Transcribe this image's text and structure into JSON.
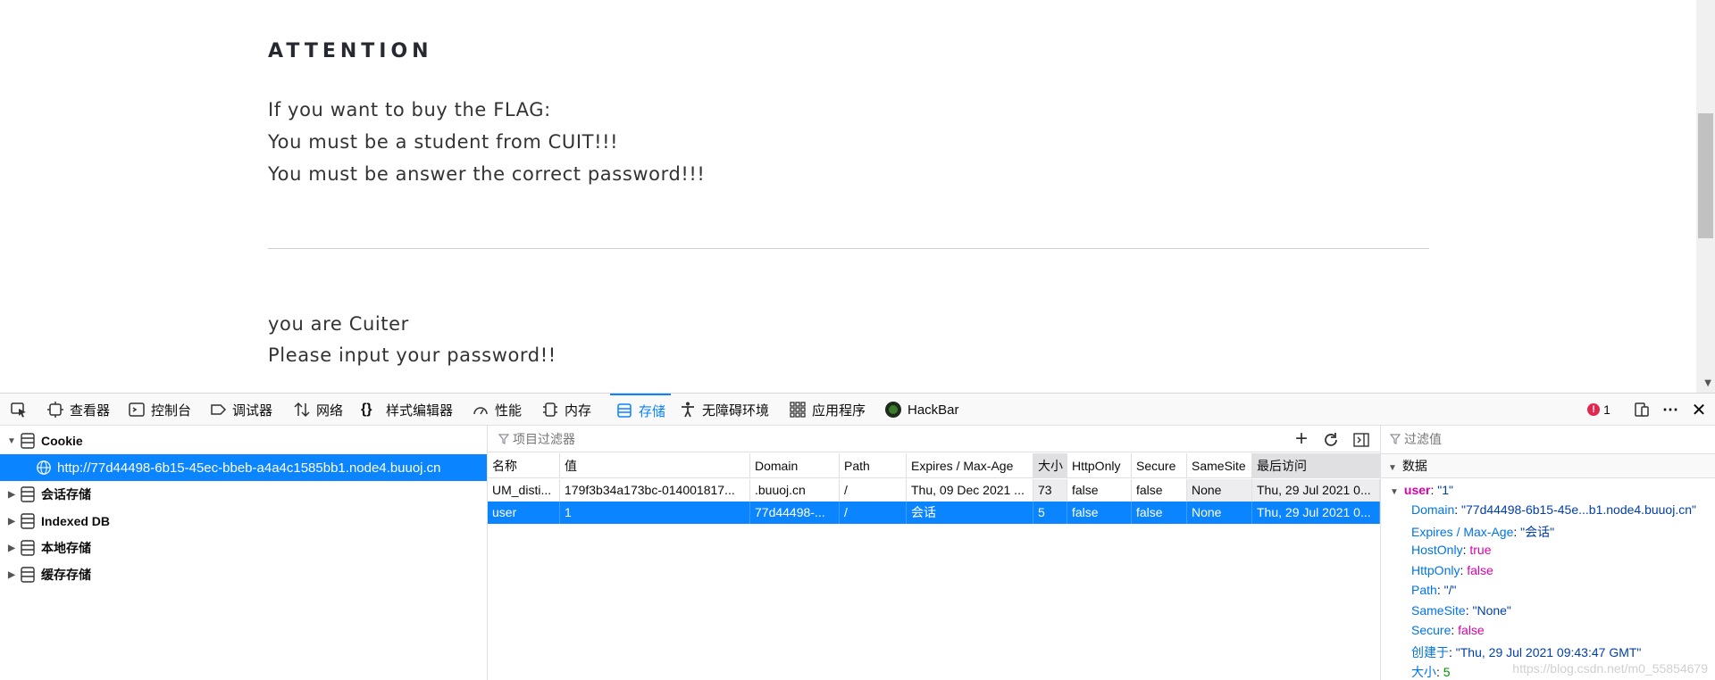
{
  "page": {
    "heading": "ATTENTION",
    "lines": [
      "If you want to buy the FLAG:",
      "You must be a student from CUIT!!!",
      "You must be answer the correct password!!!"
    ],
    "lines2": [
      "you are Cuiter",
      "Please input your password!!"
    ]
  },
  "devtools": {
    "tools": [
      {
        "label": "查看器",
        "icon": "inspector-icon"
      },
      {
        "label": "控制台",
        "icon": "console-icon"
      },
      {
        "label": "调试器",
        "icon": "debugger-icon"
      },
      {
        "label": "网络",
        "icon": "network-icon"
      },
      {
        "label": "样式编辑器",
        "icon": "style-editor-icon"
      },
      {
        "label": "性能",
        "icon": "performance-icon"
      },
      {
        "label": "内存",
        "icon": "memory-icon"
      },
      {
        "label": "存储",
        "icon": "storage-icon"
      },
      {
        "label": "无障碍环境",
        "icon": "accessibility-icon"
      },
      {
        "label": "应用程序",
        "icon": "application-icon"
      },
      {
        "label": "HackBar",
        "icon": "hackbar-icon"
      }
    ],
    "error_count": "1",
    "tree": {
      "cookie_label": "Cookie",
      "cookie_host": "http://77d44498-6b15-45ec-bbeb-a4a4c1585bb1.node4.buuoj.cn",
      "session_storage": "会话存储",
      "indexed_db": "Indexed DB",
      "local_storage": "本地存储",
      "cache_storage": "缓存存储"
    },
    "table": {
      "filter_placeholder": "项目过滤器",
      "columns": [
        "名称",
        "值",
        "Domain",
        "Path",
        "Expires / Max-Age",
        "大小",
        "HttpOnly",
        "Secure",
        "SameSite",
        "最后访问"
      ],
      "rows": [
        [
          "UM_disti...",
          "179f3b34a173bc-014001817...",
          ".buuoj.cn",
          "/",
          "Thu, 09 Dec 2021 ...",
          "73",
          "false",
          "false",
          "None",
          "Thu, 29 Jul 2021 0..."
        ],
        [
          "user",
          "1",
          "77d44498-...",
          "/",
          "会话",
          "5",
          "false",
          "false",
          "None",
          "Thu, 29 Jul 2021 0..."
        ]
      ]
    },
    "sidebar": {
      "filter_placeholder": "过滤值",
      "section": "数据",
      "root_key": "user",
      "root_value": "\"1\"",
      "props": [
        {
          "k": "Domain",
          "v": "\"77d44498-6b15-45e...b1.node4.buuoj.cn\"",
          "t": "str"
        },
        {
          "k": "Expires / Max-Age",
          "v": "\"会话\"",
          "t": "str"
        },
        {
          "k": "HostOnly",
          "v": "true",
          "t": "bool"
        },
        {
          "k": "HttpOnly",
          "v": "false",
          "t": "bool"
        },
        {
          "k": "Path",
          "v": "\"/\"",
          "t": "str"
        },
        {
          "k": "SameSite",
          "v": "\"None\"",
          "t": "str"
        },
        {
          "k": "Secure",
          "v": "false",
          "t": "bool"
        },
        {
          "k": "创建于",
          "v": "\"Thu, 29 Jul 2021 09:43:47 GMT\"",
          "t": "str"
        },
        {
          "k": "大小",
          "v": "5",
          "t": "num"
        }
      ],
      "watermark": "https://blog.csdn.net/m0_55854679"
    }
  }
}
